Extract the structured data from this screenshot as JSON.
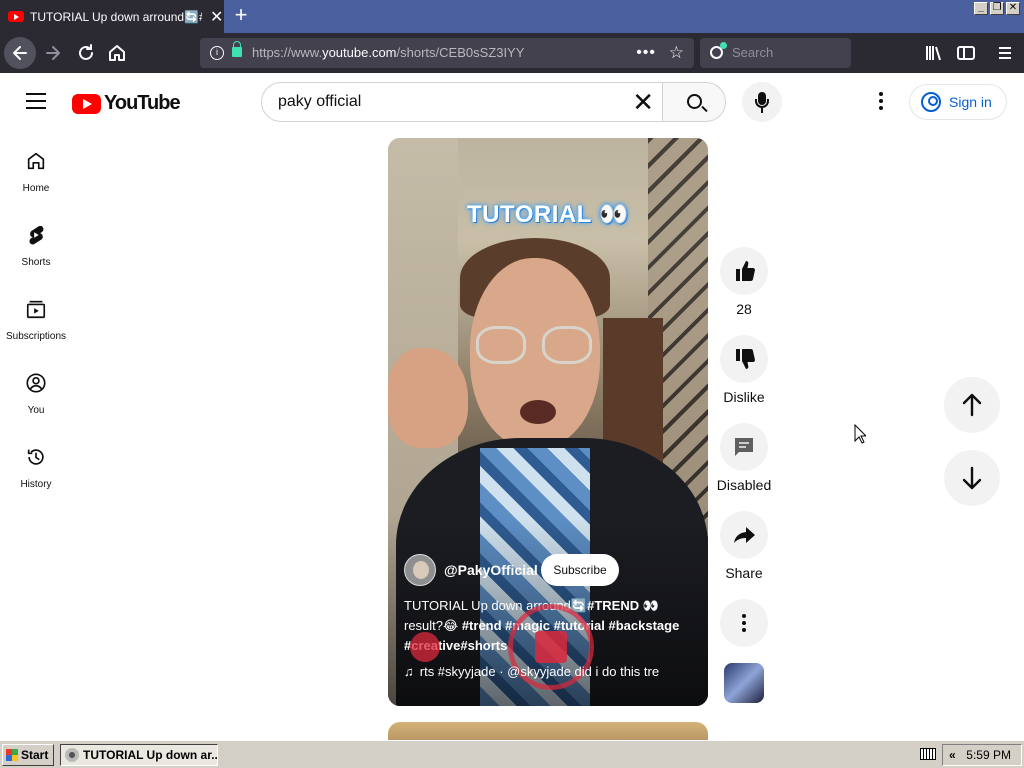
{
  "browser": {
    "tab_title": "TUTORIAL Up down arround🔄#TREND",
    "tab_close": "✕",
    "new_tab": "+",
    "url_prefix": "https://www.",
    "url_host": "youtube.com",
    "url_path": "/shorts/CEB0sSZ3IYY",
    "search_placeholder": "Search",
    "window_controls": [
      "_",
      "❐",
      "✕"
    ]
  },
  "youtube": {
    "logo_text": "YouTube",
    "search_value": "paky official",
    "signin_label": "Sign in",
    "sidebar": [
      {
        "label": "Home",
        "icon": "home-icon"
      },
      {
        "label": "Shorts",
        "icon": "shorts-icon"
      },
      {
        "label": "Subscriptions",
        "icon": "subscriptions-icon"
      },
      {
        "label": "You",
        "icon": "you-icon"
      },
      {
        "label": "History",
        "icon": "history-icon"
      }
    ],
    "short": {
      "overlay_title": "TUTORIAL 👀",
      "channel_name": "@PakyOfficial",
      "subscribe_label": "Subscribe",
      "desc_plain_1": "TUTORIAL Up down arround🔄",
      "desc_tag_1": "#TREND",
      "desc_emoji": " 👀",
      "desc_plain_2": "result?😂 ",
      "desc_tags_2": "#trend #magic #tutorial #backstage",
      "desc_tags_3": "#creative#shorts",
      "music_note": "♫",
      "music_text": "rts #skyyjade · @skyyjade    did i do this tre"
    },
    "actions": {
      "like_count": "28",
      "dislike_label": "Dislike",
      "comments_label": "Disabled",
      "share_label": "Share"
    }
  },
  "taskbar": {
    "start_label": "Start",
    "task_label": "TUTORIAL Up down ar...",
    "tray_arrow": "«",
    "clock": "5:59 PM"
  }
}
